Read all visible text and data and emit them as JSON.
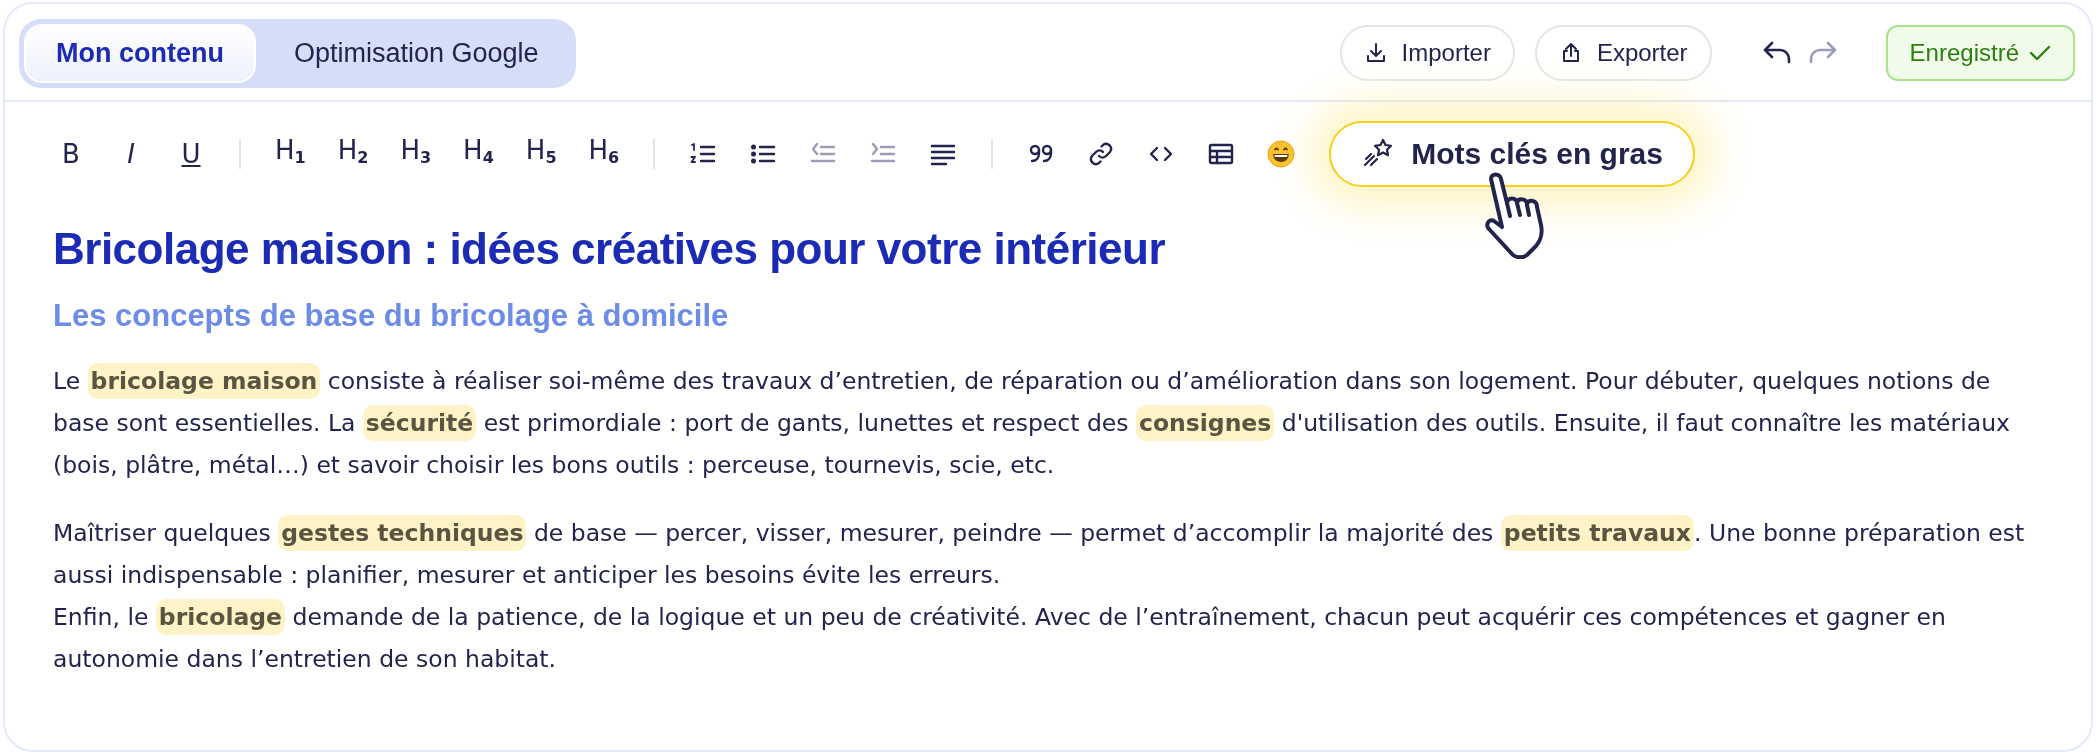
{
  "tabs": [
    {
      "label": "Mon contenu",
      "selected": true
    },
    {
      "label": "Optimisation Google",
      "selected": false
    }
  ],
  "actions": [
    {
      "kind": "import",
      "label": "Importer"
    },
    {
      "kind": "export",
      "label": "Exporter"
    }
  ],
  "history": [
    {
      "kind": "undo",
      "disabled": false
    },
    {
      "kind": "redo",
      "disabled": true
    }
  ],
  "save_status": {
    "label": "Enregistré"
  },
  "toolbar": [
    {
      "kind": "bold",
      "text": "B",
      "disabled": false
    },
    {
      "kind": "italic",
      "text": "I",
      "disabled": false
    },
    {
      "kind": "underline",
      "text": "U",
      "disabled": false
    },
    {
      "kind": "divider"
    },
    {
      "kind": "heading",
      "text": "H",
      "sub": "1",
      "disabled": false
    },
    {
      "kind": "heading",
      "text": "H",
      "sub": "2",
      "disabled": false
    },
    {
      "kind": "heading",
      "text": "H",
      "sub": "3",
      "disabled": false
    },
    {
      "kind": "heading",
      "text": "H",
      "sub": "4",
      "disabled": false
    },
    {
      "kind": "heading",
      "text": "H",
      "sub": "5",
      "disabled": false
    },
    {
      "kind": "heading",
      "text": "H",
      "sub": "6",
      "disabled": false
    },
    {
      "kind": "divider"
    },
    {
      "kind": "ordered-list",
      "disabled": false
    },
    {
      "kind": "bullet-list",
      "disabled": false
    },
    {
      "kind": "outdent",
      "disabled": true
    },
    {
      "kind": "indent",
      "disabled": true
    },
    {
      "kind": "align",
      "disabled": false
    },
    {
      "kind": "divider"
    },
    {
      "kind": "quote",
      "disabled": false
    },
    {
      "kind": "link",
      "disabled": false
    },
    {
      "kind": "code",
      "disabled": false
    },
    {
      "kind": "table",
      "disabled": false
    },
    {
      "kind": "emoji",
      "disabled": false
    }
  ],
  "keyword_button": {
    "label": "Mots clés en gras"
  },
  "document": {
    "title": "Bricolage maison : idées créatives pour votre intérieur",
    "subtitle": "Les concepts de base du bricolage à domicile",
    "paragraphs": [
      {
        "lines": [
          "Le **bricolage maison** consiste à réaliser soi-même des travaux d’entretien, de réparation ou d’amélioration dans son logement. Pour débuter, quelques notions de base sont essentielles. La **sécurité** est primordiale : port de gants, lunettes et respect des **consignes** d'utilisation des outils. Ensuite, il faut connaître les matériaux (bois, plâtre, métal…) et savoir choisir les bons outils : perceuse, tournevis, scie, etc."
        ]
      },
      {
        "lines": [
          "Maîtriser quelques **gestes techniques** de base — percer, visser, mesurer, peindre — permet d’accomplir la majorité des **petits travaux**. Une bonne préparation est aussi indispensable : planifier, mesurer et anticiper les besoins évite les erreurs.",
          "Enfin, le **bricolage** demande de la patience, de la logique et un peu de créativité. Avec de l’entraînement, chacun peut acquérir ces compétences et gagner en autonomie dans l’entretien de son habitat."
        ]
      }
    ]
  }
}
